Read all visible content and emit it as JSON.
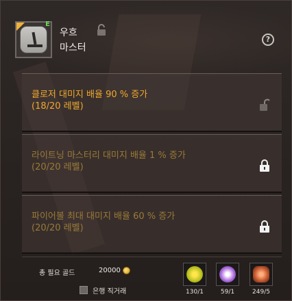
{
  "skill": {
    "name": "우흐",
    "rank": "마스터",
    "badge": "E",
    "icon": "stone-clock-icon"
  },
  "help_label": "?",
  "options": [
    {
      "title": "클로저 대미지 배율 90 % 증가",
      "level": "(18/20 레벨)",
      "state": "unlocked"
    },
    {
      "title": "라이트닝 마스터리 대미지 배율 1 % 증가",
      "level": "(20/20 레벨)",
      "state": "locked"
    },
    {
      "title": "파이어볼 최대 대미지 배율 60 % 증가",
      "level": "(20/20 레벨)",
      "state": "locked"
    }
  ],
  "footer": {
    "cost_label": "총 필요 골드",
    "cost_value": "20000",
    "bank_label": "은행 직거래",
    "materials": [
      {
        "icon": "yellow-sun-material-icon",
        "count": "130/1"
      },
      {
        "icon": "purple-orb-material-icon",
        "count": "59/1"
      },
      {
        "icon": "orange-horn-material-icon",
        "count": "249/5"
      }
    ]
  },
  "colors": {
    "active_text": "#f0a830",
    "inactive_text": "#9a7a38",
    "badge": "#6bd85c"
  }
}
